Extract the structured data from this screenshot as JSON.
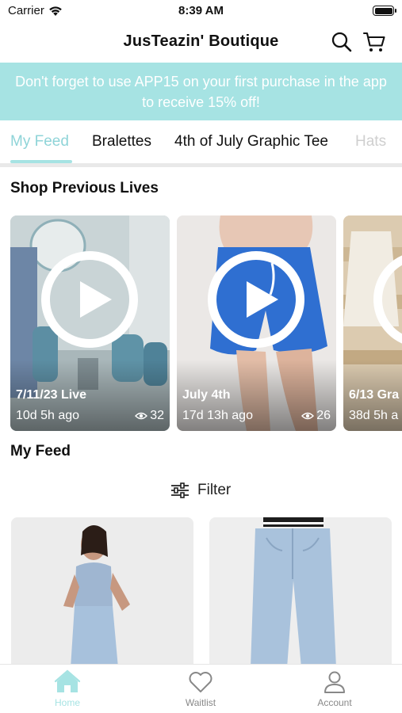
{
  "status_bar": {
    "carrier": "Carrier",
    "time": "8:39 AM"
  },
  "header": {
    "title": "JusTeazin' Boutique",
    "icons": [
      "search-icon",
      "cart-icon"
    ]
  },
  "promo": {
    "text": "Don't forget to use APP15 on your first purchase in the app to receive 15% off!",
    "background": "#a6e3e3"
  },
  "tabs": [
    {
      "label": "My Feed",
      "active": true
    },
    {
      "label": "Bralettes",
      "active": false
    },
    {
      "label": "4th of July Graphic Tee",
      "active": false
    },
    {
      "label": "Hats",
      "active": false
    }
  ],
  "sections": {
    "lives_title": "Shop Previous Lives",
    "feed_title": "My Feed"
  },
  "lives": [
    {
      "title": "7/11/23 Live",
      "ago": "10d 5h ago",
      "views": "32"
    },
    {
      "title": "July 4th",
      "ago": "17d 13h ago",
      "views": "26"
    },
    {
      "title": "6/13 Gra",
      "ago": "38d 5h a",
      "views": ""
    }
  ],
  "filter": {
    "label": "Filter"
  },
  "bottom_nav": [
    {
      "label": "Home",
      "icon": "home-icon",
      "active": true
    },
    {
      "label": "Waitlist",
      "icon": "heart-icon",
      "active": false
    },
    {
      "label": "Account",
      "icon": "account-icon",
      "active": false
    }
  ],
  "colors": {
    "accent": "#a6e3e3",
    "active_tab": "#8fd4d8"
  }
}
